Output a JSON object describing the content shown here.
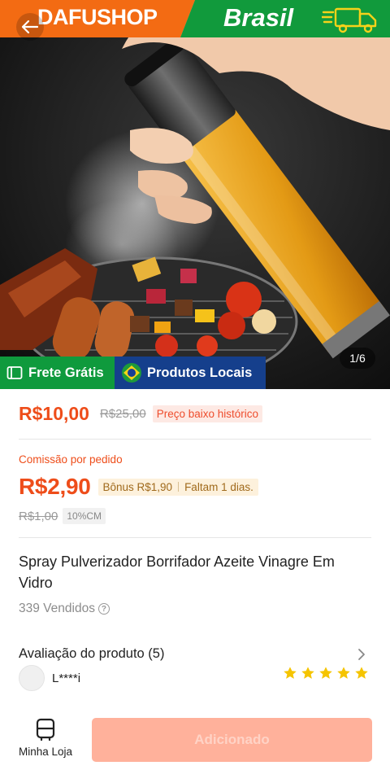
{
  "banner": {
    "shop_name": "DAFUSHOP",
    "country": "Brasil",
    "shop_color": "#f36b13",
    "country_color": "#119a3c"
  },
  "gallery": {
    "counter": "1/6",
    "tags": {
      "shipping": "Frete Grátis",
      "local": "Produtos Locais"
    }
  },
  "price": {
    "current": "R$10,00",
    "original": "R$25,00",
    "badge": "Preço baixo histórico"
  },
  "commission": {
    "label": "Comissão por pedido",
    "value": "R$2,90",
    "bonus": "Bônus R$1,90",
    "days_left": "Faltam 1 dias.",
    "old_value": "R$1,00",
    "rate": "10%CM"
  },
  "product": {
    "title": "Spray Pulverizador Borrifador Azeite Vinagre Em Vidro",
    "sold": "339 Vendidos"
  },
  "reviews": {
    "title": "Avaliação do produto (5)",
    "reviewer": "L****i",
    "rating": 5
  },
  "bottom_bar": {
    "store_label": "Minha Loja",
    "add_button": "Adicionado"
  },
  "colors": {
    "accent": "#ee4d1a",
    "star": "#f5c400",
    "button_disabled": "#ffb19b"
  },
  "icons": [
    "back-arrow-icon",
    "truck-icon",
    "store-icon",
    "info-icon",
    "chevron-right-icon",
    "star-icon",
    "brazil-flag-icon",
    "shipping-icon"
  ]
}
